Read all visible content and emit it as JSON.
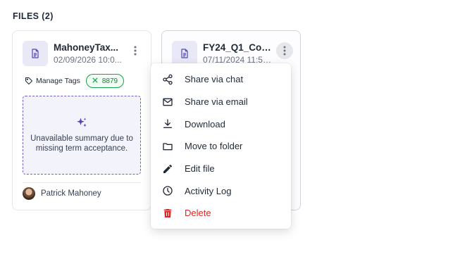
{
  "section": {
    "title": "FILES (2)"
  },
  "files": [
    {
      "name": "MahoneyTax...",
      "date": "02/09/2026 10:0...",
      "manage_tags_label": "Manage Tags",
      "tag": "8879",
      "summary": "Unavailable summary due to missing term acceptance.",
      "owner": "Patrick Mahoney"
    },
    {
      "name": "FY24_Q1_Con...",
      "date": "07/11/2024 11:50..."
    }
  ],
  "menu": {
    "items": [
      {
        "label": "Share via chat",
        "icon": "share-icon"
      },
      {
        "label": "Share via email",
        "icon": "mail-icon"
      },
      {
        "label": "Download",
        "icon": "download-icon"
      },
      {
        "label": "Move to folder",
        "icon": "folder-icon"
      },
      {
        "label": "Edit file",
        "icon": "pencil-icon"
      },
      {
        "label": "Activity Log",
        "icon": "clock-icon"
      },
      {
        "label": "Delete",
        "icon": "trash-icon"
      }
    ]
  },
  "colors": {
    "accent": "#4f46b8",
    "tag_green": "#16a34a",
    "danger": "#dc2626",
    "text": "#1f2937"
  }
}
